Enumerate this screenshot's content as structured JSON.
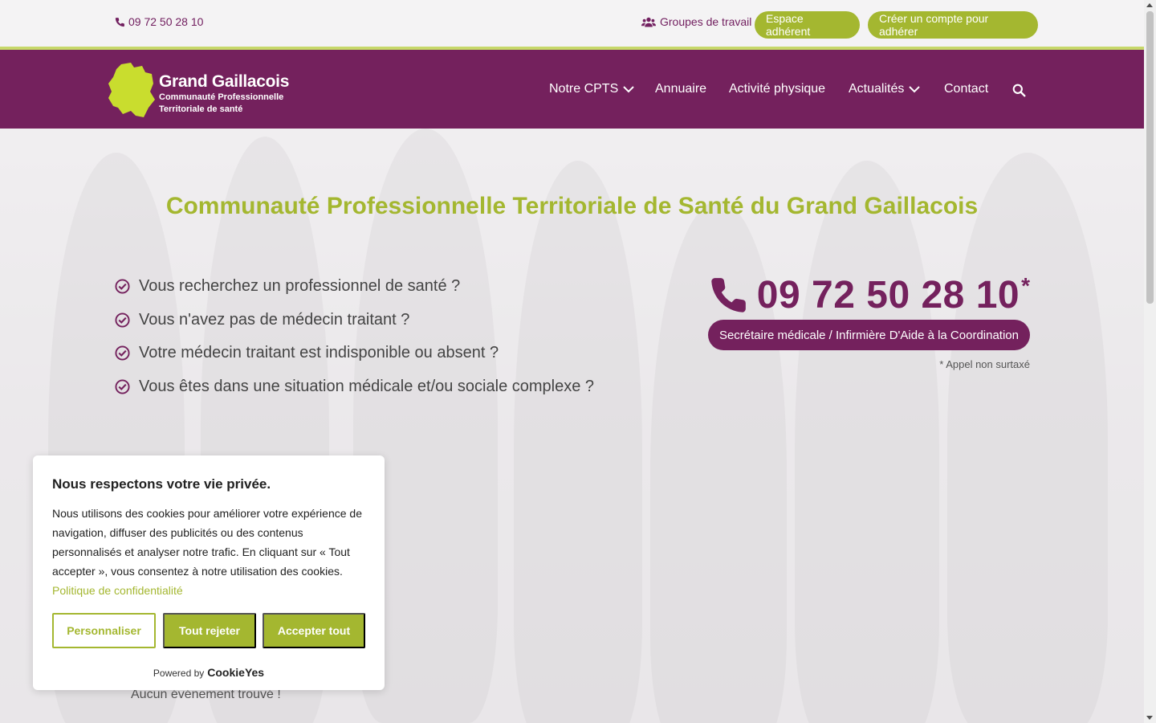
{
  "topbar": {
    "phone": "09 72 50 28 10",
    "groups": "Groupes de travail",
    "espace": "Espace adhérent",
    "creer": "Créer un compte pour adhérer"
  },
  "logo": {
    "brand": "Grand Gaillacois",
    "line1": "Communauté Professionnelle",
    "line2": "Territoriale de santé"
  },
  "nav": {
    "items": [
      "Notre CPTS",
      "Annuaire",
      "Activité physique",
      "Actualités",
      "Contact"
    ]
  },
  "hero": {
    "title": "Communauté Professionnelle Territoriale de Santé du Grand Gaillacois",
    "questions": [
      "Vous recherchez un professionnel de santé ?",
      "Vous n'avez pas de médecin traitant ?",
      "Votre médecin traitant est indisponible ou absent ?",
      "Vous êtes dans une situation médicale et/ou sociale complexe ?"
    ],
    "phone": "09 72 50 28 10",
    "star": "*",
    "secretary": "Secrétaire médicale / Infirmière D'Aide à la Coordination",
    "note": "* Appel non surtaxé",
    "no_event": "Aucun événement trouvé !"
  },
  "cookie": {
    "title": "Nous respectons votre vie privée.",
    "text": "Nous utilisons des cookies pour améliorer votre expérience de navigation, diffuser des publicités ou des contenus personnalisés et analyser notre trafic. En cliquant sur « Tout accepter », vous consentez à notre utilisation des cookies.",
    "policy": "Politique de confidentialité",
    "customize": "Personnaliser",
    "reject": "Tout rejeter",
    "accept": "Accepter tout",
    "powered": "Powered by",
    "brand": "CookieYes"
  },
  "colors": {
    "primary": "#74215d",
    "accent": "#a4b730"
  }
}
